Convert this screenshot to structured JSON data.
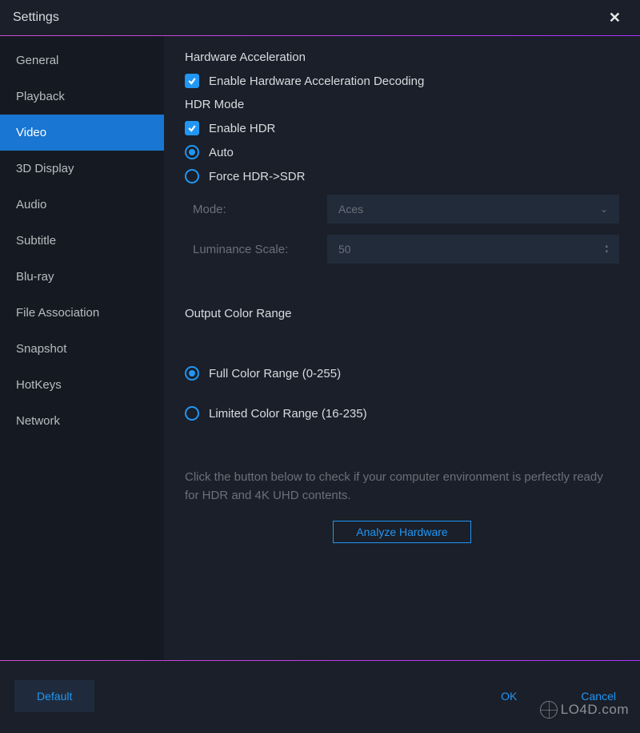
{
  "titlebar": {
    "title": "Settings"
  },
  "sidebar": {
    "items": [
      {
        "label": "General"
      },
      {
        "label": "Playback"
      },
      {
        "label": "Video",
        "active": true
      },
      {
        "label": "3D Display"
      },
      {
        "label": "Audio"
      },
      {
        "label": "Subtitle"
      },
      {
        "label": "Blu-ray"
      },
      {
        "label": "File Association"
      },
      {
        "label": "Snapshot"
      },
      {
        "label": "HotKeys"
      },
      {
        "label": "Network"
      }
    ]
  },
  "content": {
    "hwaccel_title": "Hardware Acceleration",
    "hwaccel_checkbox_label": "Enable Hardware Acceleration Decoding",
    "hdr_title": "HDR Mode",
    "hdr_checkbox_label": "Enable HDR",
    "hdr_radio_auto": "Auto",
    "hdr_radio_force": "Force HDR->SDR",
    "mode_label": "Mode:",
    "mode_value": "Aces",
    "luminance_label": "Luminance Scale:",
    "luminance_value": "50",
    "output_color_title": "Output Color Range",
    "color_full_label": "Full Color Range (0-255)",
    "color_limited_label": "Limited Color Range (16-235)",
    "hint_text": "Click the button below to check if your computer environment is perfectly ready for HDR and 4K UHD contents.",
    "analyze_button": "Analyze Hardware"
  },
  "footer": {
    "default_button": "Default",
    "ok_button": "OK",
    "cancel_button": "Cancel"
  },
  "watermark": "LO4D.com"
}
